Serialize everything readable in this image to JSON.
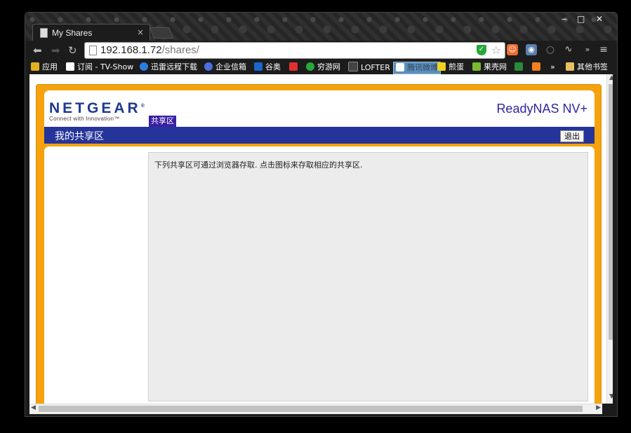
{
  "browser": {
    "tab_title": "My Shares",
    "tab_close": "×",
    "url_host": "192.168.1.72",
    "url_path": "/shares/",
    "window_controls": [
      "‒",
      "□",
      "✕"
    ]
  },
  "bookmarks": [
    {
      "label": "应用",
      "icon": "apps-grid-icon",
      "color": "#e0b020"
    },
    {
      "label": "订阅 - TV-Show",
      "icon": "subscription-icon",
      "color": "#ffffff"
    },
    {
      "label": "迅雷远程下载",
      "icon": "xunlei-icon",
      "color": "#2a7de0"
    },
    {
      "label": "企业信箱",
      "icon": "enterprise-mail-icon",
      "color": "#4a6fe0"
    },
    {
      "label": "谷奥",
      "icon": "guao-icon",
      "color": "#1a66cc"
    },
    {
      "label": "",
      "icon": "mail-icon",
      "color": "#e03030"
    },
    {
      "label": "穷游网",
      "icon": "qyer-icon",
      "color": "#27a83b"
    },
    {
      "label": "LOFTER",
      "icon": "lofter-icon",
      "color": "#444444"
    },
    {
      "label": "腾讯微博",
      "icon": "weibo-icon",
      "color": "#5a8fc0"
    },
    {
      "label": "煎蛋",
      "icon": "jandan-icon",
      "color": "#f0d020"
    },
    {
      "label": "果壳网",
      "icon": "guokr-icon",
      "color": "#7ab830"
    },
    {
      "label": "",
      "icon": "douban-icon",
      "color": "#2a8a3a"
    },
    {
      "label": "",
      "icon": "fox-icon",
      "color": "#f08020"
    },
    {
      "label": "»",
      "icon": "",
      "color": ""
    },
    {
      "label": "其他书签",
      "icon": "folder-icon",
      "color": "#e8c060"
    }
  ],
  "nas": {
    "brand": "NETGEAR",
    "brand_mark": "®",
    "tagline": "Connect with Innovation™",
    "product": "ReadyNAS NV+",
    "tab_label": "共享区",
    "section_heading": "我的共享区",
    "logout_label": "退出",
    "message": "下列共享区可通过浏览器存取. 点击图标来存取相应的共享区."
  },
  "colors": {
    "nas_orange": "#f5a20e",
    "nas_blue": "#25349a",
    "tab_purple": "#3a1fa3",
    "panel_gray": "#ececec"
  }
}
